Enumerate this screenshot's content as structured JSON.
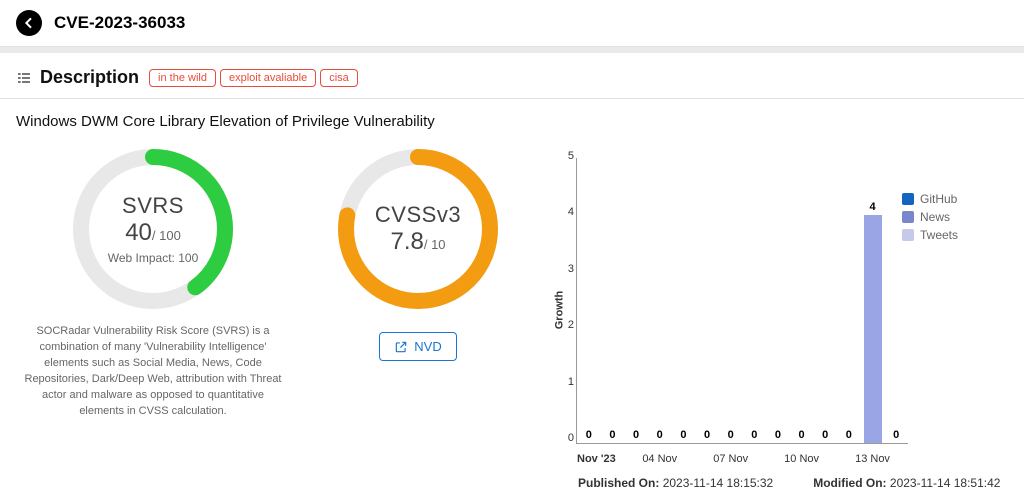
{
  "header": {
    "cve_id": "CVE-2023-36033"
  },
  "section": {
    "title": "Description",
    "tags": [
      "in the wild",
      "exploit avaliable",
      "cisa"
    ]
  },
  "short_description": "Windows DWM Core Library Elevation of Privilege Vulnerability",
  "svrs": {
    "label": "SVRS",
    "value": "40",
    "max": "/ 100",
    "sub": "Web Impact: 100",
    "percent": 40,
    "desc": "SOCRadar Vulnerability Risk Score (SVRS) is a combination of many 'Vulnerability Intelligence' elements such as Social Media, News, Code Repositories, Dark/Deep Web, attribution with Threat actor and malware as opposed to quantitative elements in CVSS calculation."
  },
  "cvss": {
    "label": "CVSSv3",
    "value": "7.8",
    "max": "/ 10",
    "percent": 78
  },
  "nvd_button": "NVD",
  "chart_data": {
    "type": "bar",
    "title": "",
    "ylabel": "Growth",
    "ylim": [
      0,
      5
    ],
    "yticks": [
      5,
      4,
      3,
      2,
      1,
      0
    ],
    "xticks": [
      "Nov '23",
      "04 Nov",
      "07 Nov",
      "10 Nov",
      "13 Nov"
    ],
    "series": [
      {
        "name": "GitHub",
        "color": "#1565c0"
      },
      {
        "name": "News",
        "color": "#7986cb"
      },
      {
        "name": "Tweets",
        "color": "#c5cae9"
      }
    ],
    "bars": [
      {
        "label": "0",
        "value": 0
      },
      {
        "label": "0",
        "value": 0
      },
      {
        "label": "0",
        "value": 0
      },
      {
        "label": "0",
        "value": 0
      },
      {
        "label": "0",
        "value": 0
      },
      {
        "label": "0",
        "value": 0
      },
      {
        "label": "0",
        "value": 0
      },
      {
        "label": "0",
        "value": 0
      },
      {
        "label": "0",
        "value": 0
      },
      {
        "label": "0",
        "value": 0
      },
      {
        "label": "0",
        "value": 0
      },
      {
        "label": "0",
        "value": 0
      },
      {
        "label": "4",
        "value": 4
      },
      {
        "label": "0",
        "value": 0
      }
    ]
  },
  "meta": {
    "published_label": "Published On:",
    "published_value": "2023-11-14 18:15:32",
    "modified_label": "Modified On:",
    "modified_value": "2023-11-14 18:51:42"
  }
}
